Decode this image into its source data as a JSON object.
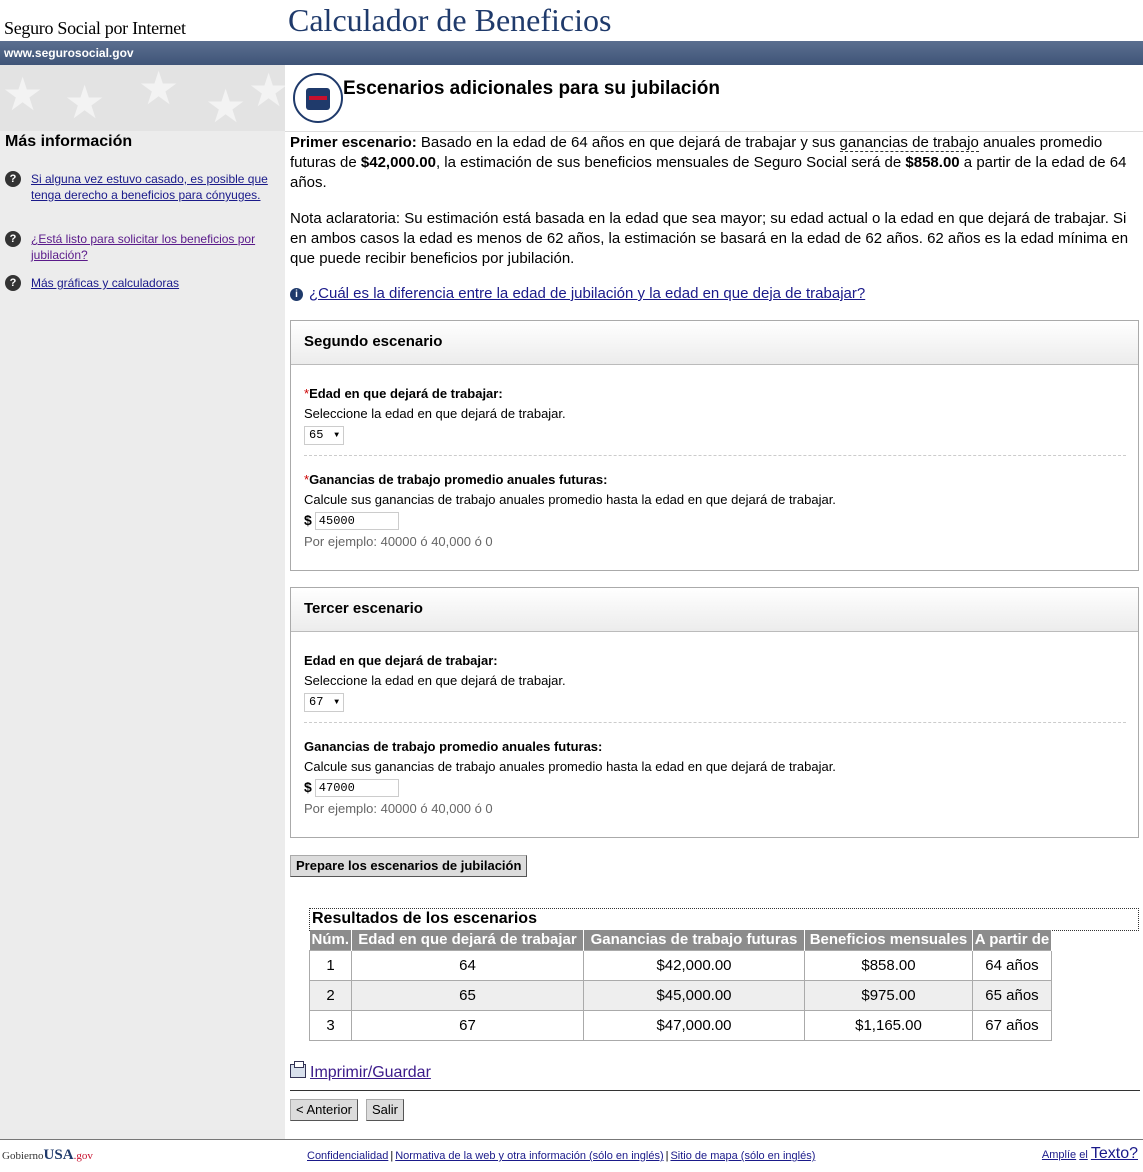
{
  "header": {
    "brand": "Seguro Social por Internet",
    "app_title": "Calculador de Beneficios",
    "url": "www.segurosocial.gov"
  },
  "sidebar": {
    "heading": "Más información",
    "links": [
      {
        "label": "Si alguna vez estuvo casado, es posible que tenga derecho a beneficios para cónyuges.",
        "icon": "question-circle-icon"
      },
      {
        "label": "¿Está listo para solicitar los beneficios por jubilación?",
        "icon": "question-circle-icon"
      },
      {
        "label": "Más gráficas y calculadoras",
        "icon": "question-circle-icon"
      }
    ]
  },
  "main": {
    "heading": "Escenarios adicionales para su jubilación",
    "scenario1": {
      "label": "Primer escenario:",
      "text_a": " Basado en la edad de 64 años en que dejará de trabajar y sus ",
      "term": "ganancias de trabajo",
      "text_b": " anuales promedio futuras de ",
      "amount": "$42,000.00",
      "text_c": ", la estimación de sus beneficios mensuales de Seguro Social será de ",
      "benefit": "$858.00",
      "text_d": " a partir de la edad de 64 años."
    },
    "note": "Nota aclaratoria: Su estimación está basada en la edad que sea mayor; su edad actual o la edad en que dejará de trabajar. Si en ambos casos la edad es menos de 62 años, la estimación se basará en la edad de 62 años. 62 años es la edad mínima en que puede recibir beneficios por jubilación.",
    "info_link": "¿Cuál es la diferencia entre la edad de jubilación y la edad en que deja de trabajar?",
    "scenario2": {
      "title": "Segundo escenario",
      "required_mark": "*",
      "age_label": "Edad en que dejará de trabajar:",
      "age_help": "Seleccione la edad en que dejará de trabajar.",
      "age_value": "65",
      "earnings_label": "Ganancias de trabajo promedio anuales futuras:",
      "earnings_help": "Calcule sus ganancias de trabajo anuales promedio hasta la edad en que dejará de trabajar.",
      "currency": "$",
      "earnings_value": "45000",
      "example": "Por ejemplo: 40000 ó 40,000 ó 0"
    },
    "scenario3": {
      "title": "Tercer escenario",
      "age_label": "Edad en que dejará de trabajar:",
      "age_help": "Seleccione la edad en que dejará de trabajar.",
      "age_value": "67",
      "earnings_label": "Ganancias de trabajo promedio anuales futuras:",
      "earnings_help": "Calcule sus ganancias de trabajo anuales promedio hasta la edad en que dejará de trabajar.",
      "currency": "$",
      "earnings_value": "47000",
      "example": "Por ejemplo: 40000 ó 40,000 ó 0"
    },
    "prepare_button": "Prepare los escenarios de jubilación",
    "results": {
      "title": "Resultados de los escenarios",
      "headers": [
        "Núm.",
        "Edad en que dejará de trabajar",
        "Ganancias de trabajo futuras",
        "Beneficios mensuales",
        "A partir de"
      ],
      "rows": [
        [
          "1",
          "64",
          "$42,000.00",
          "$858.00",
          "64 años"
        ],
        [
          "2",
          "65",
          "$45,000.00",
          "$975.00",
          "65 años"
        ],
        [
          "3",
          "67",
          "$47,000.00",
          "$1,165.00",
          "67 años"
        ]
      ]
    },
    "print_link": "Imprimir/Guardar",
    "back_button": "< Anterior",
    "exit_button": "Salir"
  },
  "footer": {
    "gov_logo_prefix": "Gobierno",
    "gov_logo_main": "USA",
    "gov_logo_suffix": ".gov",
    "links": [
      "Confidencialidad",
      "Normativa de la web y otra información (sólo en inglés)",
      "Sitio de mapa (sólo en inglés)"
    ],
    "zoom_prefix": "Amplíe",
    "zoom_el": "el",
    "zoom_text": "Texto?"
  }
}
